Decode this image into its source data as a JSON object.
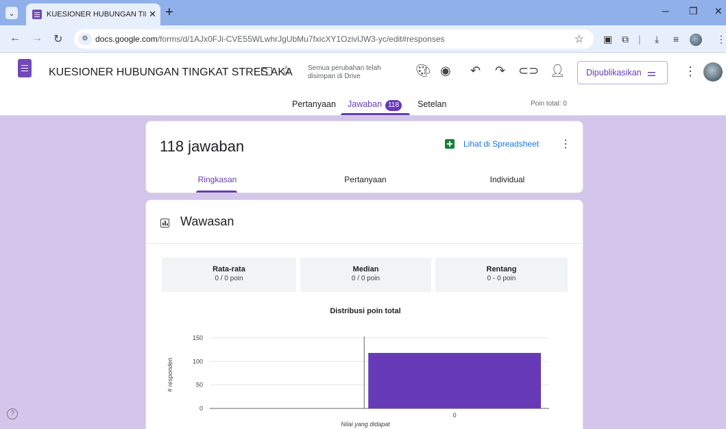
{
  "browser": {
    "tab_title": "KUESIONER HUBUNGAN TINGK",
    "url_host": "docs.google.com",
    "url_path": "/forms/d/1AJx0FJi-CVE55WLwhrJgUbMu7fxicXY1OzivlJW3-yc/edit#responses"
  },
  "header": {
    "form_title": "KUESIONER HUBUNGAN TINGKAT STRES AKA",
    "saved_status": "Semua perubahan telah disimpan di Drive",
    "publish_label": "Dipublikasikan"
  },
  "nav": {
    "tabs": [
      {
        "label": "Pertanyaan"
      },
      {
        "label": "Jawaban",
        "badge": "118"
      },
      {
        "label": "Setelan"
      }
    ],
    "total_points": "Poin total: 0"
  },
  "responses": {
    "count_title": "118 jawaban",
    "sheet_link": "Lihat di Spreadsheet",
    "subtabs": [
      "Ringkasan",
      "Pertanyaan",
      "Individual"
    ]
  },
  "insights": {
    "title": "Wawasan",
    "stats": [
      {
        "label": "Rata-rata",
        "value": "0 / 0 poin"
      },
      {
        "label": "Median",
        "value": "0 / 0 poin"
      },
      {
        "label": "Rentang",
        "value": "0 - 0 poin"
      }
    ]
  },
  "chart_data": {
    "type": "bar",
    "title": "Distribusi poin total",
    "xlabel": "Nilai yang didapat",
    "ylabel": "# responden",
    "categories": [
      "0"
    ],
    "values": [
      118
    ],
    "ylim": [
      0,
      150
    ],
    "yticks": [
      0,
      50,
      100,
      150
    ],
    "grid": true,
    "bar_color": "#673ab7"
  },
  "colors": {
    "accent": "#673ab7",
    "background": "#d3c6ea",
    "link": "#1a73e8"
  }
}
